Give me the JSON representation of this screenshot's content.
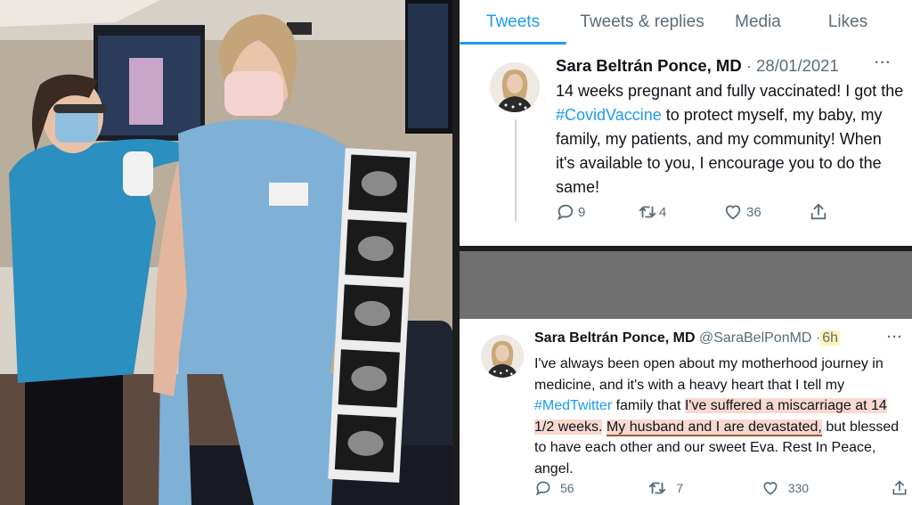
{
  "profile_tabs": {
    "tweets": "Tweets",
    "tweets_replies": "Tweets & replies",
    "media": "Media",
    "likes": "Likes"
  },
  "tweet_1": {
    "author": "Sara Beltrán Ponce, MD",
    "meta": "· 28/01/2021",
    "more": "···",
    "text_before": "14 weeks pregnant and fully vaccinated! I got the ",
    "hashtag": "#CovidVaccine",
    "text_after": " to protect myself, my baby, my family, my patients, and my community! When it's available to you, I encourage you to do the same!",
    "replies": "9",
    "retweets": "4",
    "likes": "36"
  },
  "tweet_2": {
    "author": "Sara Beltrán Ponce, MD",
    "handle": "@SaraBelPonMD",
    "dot": "·",
    "time": "6h",
    "more": "···",
    "text_1": "I've always been open about my motherhood journey in medicine, and it's with a heavy heart that I tell my ",
    "hashtag": "#MedTwitter",
    "text_2": " family that ",
    "highlight_1": "I've suffered a miscarriage at 14 1/2 weeks.",
    "text_3": " ",
    "highlight_2": "My husband and I are devastated,",
    "text_4": " but blessed to have each other and our sweet Eva. Rest In Peace, angel.",
    "replies": "56",
    "retweets": "7",
    "likes": "330"
  },
  "colors": {
    "accent": "#1d9bf0",
    "muted": "#5b6b78",
    "highlight_pink": "#f8d8cf",
    "highlight_yellow": "#fff4b3"
  },
  "icons": [
    "reply-icon",
    "retweet-icon",
    "like-icon",
    "share-icon"
  ]
}
